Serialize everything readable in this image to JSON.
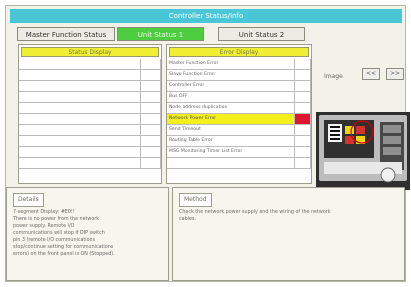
{
  "window": {
    "title": "Controller Status/Info"
  },
  "tabs": [
    {
      "label": "Master Function Status"
    },
    {
      "label": "Unit Status 1"
    },
    {
      "label": "Unit Status 2"
    }
  ],
  "status_display": {
    "header": "Status Display"
  },
  "error_display": {
    "header": "Error Display",
    "rows": [
      {
        "text": "Master Function Error"
      },
      {
        "text": "Slave Function Error"
      },
      {
        "text": "Controller Error"
      },
      {
        "text": "Bus OFF"
      },
      {
        "text": "Node address duplication"
      },
      {
        "text": "Network Power Error"
      },
      {
        "text": "Send Timeout"
      },
      {
        "text": "Routing Table Error"
      },
      {
        "text": "MSG Monitoring Timer List Error"
      }
    ]
  },
  "image_panel": {
    "label": "Image",
    "prev": "<<",
    "next": ">>"
  },
  "details": {
    "title": "Details",
    "lines": [
      "7-segment Display: #E0!!",
      "There is no power from the network",
      "power supply. Remote I/O",
      "communications will stop if DIP switch",
      "pin 3 (remote I/O communications",
      "stop/continue setting for communications",
      "errors) on the front panel is ON (Stopped)."
    ]
  },
  "method": {
    "title": "Method",
    "lines": [
      "Check the network power supply and the wiring of the network",
      "cables."
    ]
  },
  "colors": {
    "title_bar": "#49c7d6",
    "active_tab": "#4fcd41",
    "header_yellow": "#f1ef33",
    "highlight_yellow": "#f5ef1d",
    "error_red": "#e0162f"
  }
}
